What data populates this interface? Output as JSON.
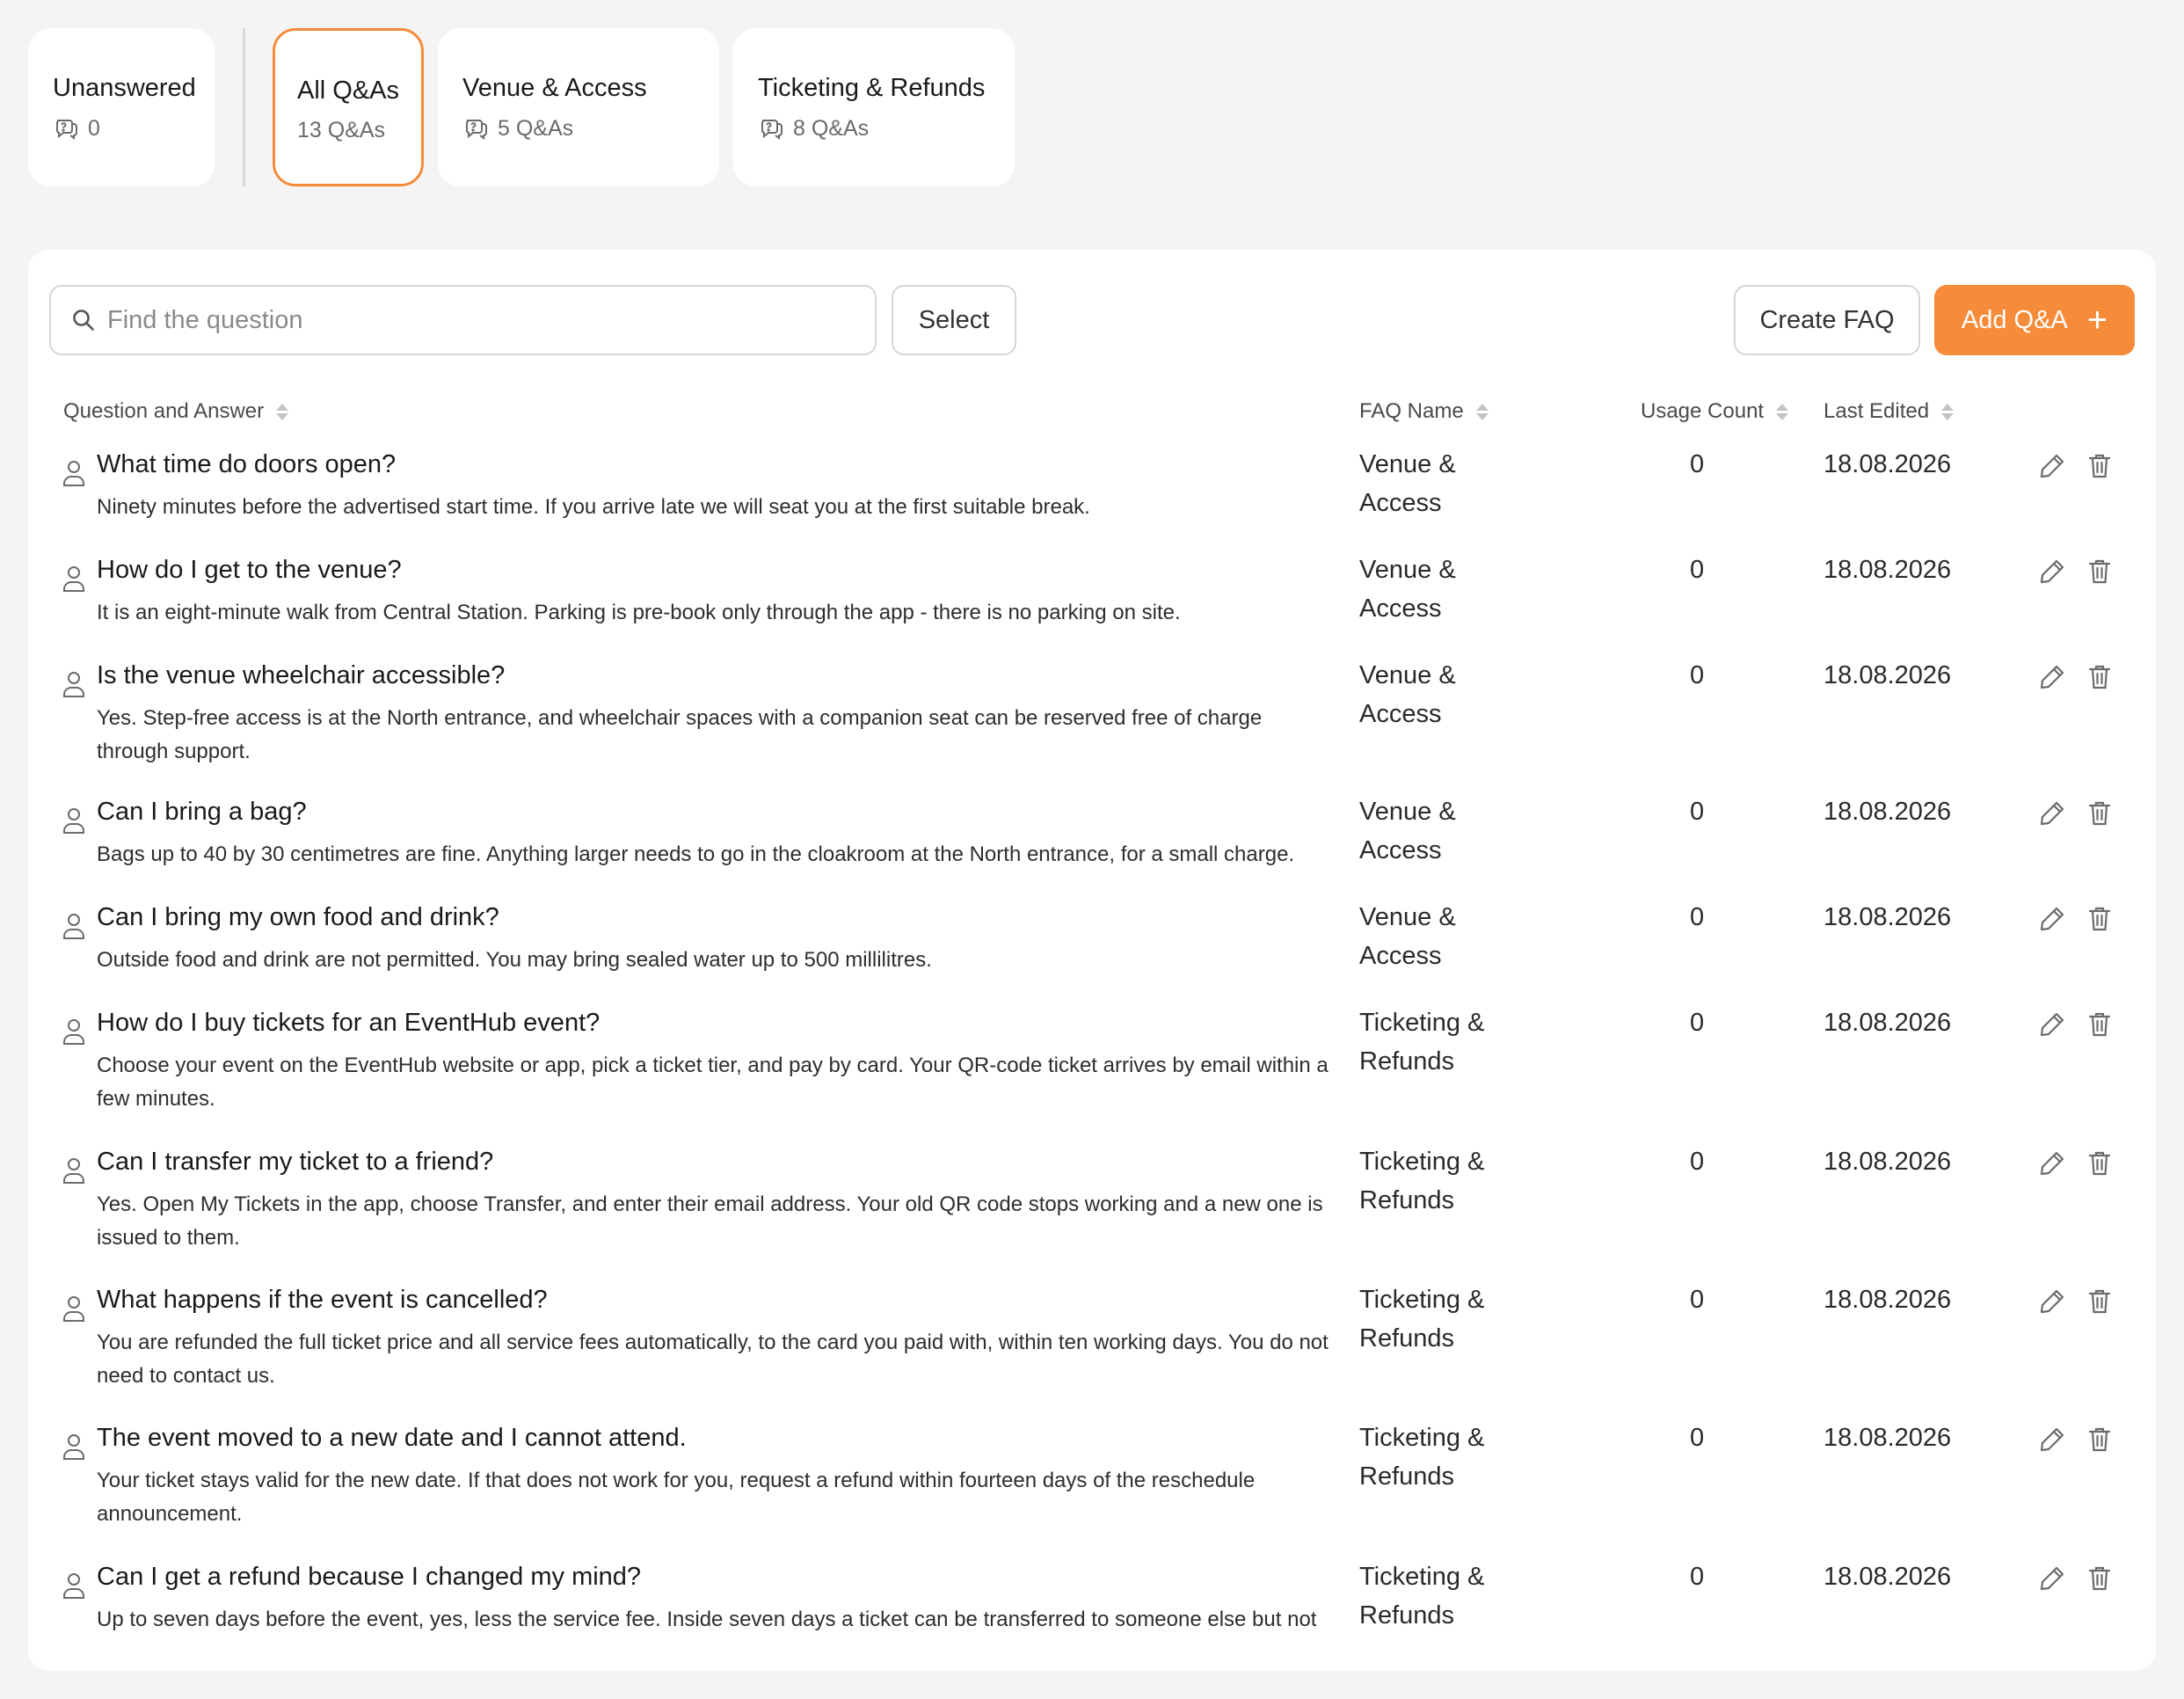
{
  "categories": [
    {
      "title": "Unanswered",
      "meta": "0",
      "active": false
    },
    {
      "title": "All Q&As",
      "meta": "13 Q&As",
      "active": true
    },
    {
      "title": "Venue & Access",
      "meta": "5 Q&As",
      "active": false
    },
    {
      "title": "Ticketing & Refunds",
      "meta": "8 Q&As",
      "active": false
    }
  ],
  "toolbar": {
    "search_placeholder": "Find the question",
    "select_label": "Select",
    "create_faq_label": "Create FAQ",
    "add_qa_label": "Add Q&A",
    "add_qa_icon": "+"
  },
  "table": {
    "columns": [
      "Question and Answer",
      "FAQ Name",
      "Usage Count",
      "Last Edited"
    ],
    "rows": [
      {
        "question": "What time do doors open?",
        "answer": "Ninety minutes before the advertised start time. If you arrive late we will seat you at the first suitable break.",
        "faq": "Venue & Access",
        "usage": "0",
        "edited": "18.08.2026"
      },
      {
        "question": "How do I get to the venue?",
        "answer": "It is an eight-minute walk from Central Station. Parking is pre-book only through the app - there is no parking on site.",
        "faq": "Venue & Access",
        "usage": "0",
        "edited": "18.08.2026"
      },
      {
        "question": "Is the venue wheelchair accessible?",
        "answer": "Yes. Step-free access is at the North entrance, and wheelchair spaces with a companion seat can be reserved free of charge through support.",
        "faq": "Venue & Access",
        "usage": "0",
        "edited": "18.08.2026"
      },
      {
        "question": "Can I bring a bag?",
        "answer": "Bags up to 40 by 30 centimetres are fine. Anything larger needs to go in the cloakroom at the North entrance, for a small charge.",
        "faq": "Venue & Access",
        "usage": "0",
        "edited": "18.08.2026"
      },
      {
        "question": "Can I bring my own food and drink?",
        "answer": "Outside food and drink are not permitted. You may bring sealed water up to 500 millilitres.",
        "faq": "Venue & Access",
        "usage": "0",
        "edited": "18.08.2026"
      },
      {
        "question": "How do I buy tickets for an EventHub event?",
        "answer": "Choose your event on the EventHub website or app, pick a ticket tier, and pay by card. Your QR-code ticket arrives by email within a few minutes.",
        "faq": "Ticketing & Refunds",
        "usage": "0",
        "edited": "18.08.2026"
      },
      {
        "question": "Can I transfer my ticket to a friend?",
        "answer": "Yes. Open My Tickets in the app, choose Transfer, and enter their email address. Your old QR code stops working and a new one is issued to them.",
        "faq": "Ticketing & Refunds",
        "usage": "0",
        "edited": "18.08.2026"
      },
      {
        "question": "What happens if the event is cancelled?",
        "answer": "You are refunded the full ticket price and all service fees automatically, to the card you paid with, within ten working days. You do not need to contact us.",
        "faq": "Ticketing & Refunds",
        "usage": "0",
        "edited": "18.08.2026"
      },
      {
        "question": "The event moved to a new date and I cannot attend.",
        "answer": "Your ticket stays valid for the new date. If that does not work for you, request a refund within fourteen days of the reschedule announcement.",
        "faq": "Ticketing & Refunds",
        "usage": "0",
        "edited": "18.08.2026"
      },
      {
        "question": "Can I get a refund because I changed my mind?",
        "answer": "Up to seven days before the event, yes, less the service fee. Inside seven days a ticket can be transferred to someone else but not",
        "faq": "Ticketing & Refunds",
        "usage": "0",
        "edited": "18.08.2026"
      }
    ]
  },
  "icons": {
    "card_meta": "question-bubble-icon",
    "search": "search-icon",
    "row_avatar": "user-icon",
    "edit": "pencil-icon",
    "delete": "trash-icon"
  },
  "colors": {
    "accent": "#f68b3a",
    "background": "#f4f4f4",
    "surface": "#ffffff",
    "border": "#d6d6d6",
    "muted_text": "#6b6b6b"
  }
}
